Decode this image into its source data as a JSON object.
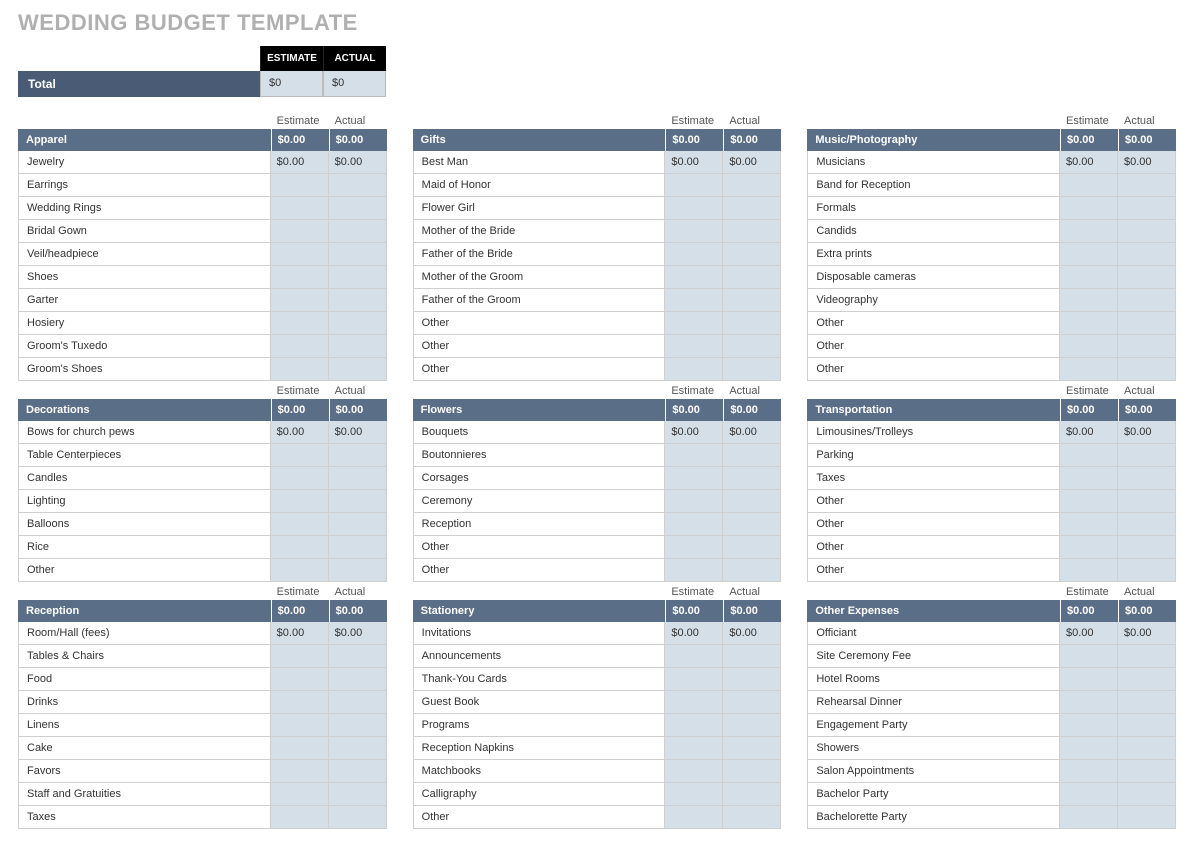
{
  "title": "WEDDING BUDGET TEMPLATE",
  "column_labels": {
    "estimate": "Estimate",
    "actual": "Actual"
  },
  "totals": {
    "head_estimate": "ESTIMATE",
    "head_actual": "ACTUAL",
    "label": "Total",
    "estimate": "$0",
    "actual": "$0"
  },
  "categories": [
    {
      "name": "Apparel",
      "estimate": "$0.00",
      "actual": "$0.00",
      "rows": [
        {
          "name": "Jewelry",
          "estimate": "$0.00",
          "actual": "$0.00"
        },
        {
          "name": "Earrings",
          "estimate": "",
          "actual": ""
        },
        {
          "name": "Wedding Rings",
          "estimate": "",
          "actual": ""
        },
        {
          "name": "Bridal Gown",
          "estimate": "",
          "actual": ""
        },
        {
          "name": "Veil/headpiece",
          "estimate": "",
          "actual": ""
        },
        {
          "name": "Shoes",
          "estimate": "",
          "actual": ""
        },
        {
          "name": "Garter",
          "estimate": "",
          "actual": ""
        },
        {
          "name": "Hosiery",
          "estimate": "",
          "actual": ""
        },
        {
          "name": "Groom's Tuxedo",
          "estimate": "",
          "actual": ""
        },
        {
          "name": "Groom's Shoes",
          "estimate": "",
          "actual": ""
        }
      ]
    },
    {
      "name": "Gifts",
      "estimate": "$0.00",
      "actual": "$0.00",
      "rows": [
        {
          "name": "Best Man",
          "estimate": "$0.00",
          "actual": "$0.00"
        },
        {
          "name": "Maid of Honor",
          "estimate": "",
          "actual": ""
        },
        {
          "name": "Flower Girl",
          "estimate": "",
          "actual": ""
        },
        {
          "name": "Mother of the Bride",
          "estimate": "",
          "actual": ""
        },
        {
          "name": "Father of the Bride",
          "estimate": "",
          "actual": ""
        },
        {
          "name": "Mother of the Groom",
          "estimate": "",
          "actual": ""
        },
        {
          "name": "Father of the Groom",
          "estimate": "",
          "actual": ""
        },
        {
          "name": "Other",
          "estimate": "",
          "actual": ""
        },
        {
          "name": "Other",
          "estimate": "",
          "actual": ""
        },
        {
          "name": "Other",
          "estimate": "",
          "actual": ""
        }
      ]
    },
    {
      "name": "Music/Photography",
      "estimate": "$0.00",
      "actual": "$0.00",
      "rows": [
        {
          "name": "Musicians",
          "estimate": "$0.00",
          "actual": "$0.00"
        },
        {
          "name": "Band for Reception",
          "estimate": "",
          "actual": ""
        },
        {
          "name": "Formals",
          "estimate": "",
          "actual": ""
        },
        {
          "name": "Candids",
          "estimate": "",
          "actual": ""
        },
        {
          "name": "Extra prints",
          "estimate": "",
          "actual": ""
        },
        {
          "name": "Disposable cameras",
          "estimate": "",
          "actual": ""
        },
        {
          "name": "Videography",
          "estimate": "",
          "actual": ""
        },
        {
          "name": "Other",
          "estimate": "",
          "actual": ""
        },
        {
          "name": "Other",
          "estimate": "",
          "actual": ""
        },
        {
          "name": "Other",
          "estimate": "",
          "actual": ""
        }
      ]
    },
    {
      "name": "Decorations",
      "estimate": "$0.00",
      "actual": "$0.00",
      "rows": [
        {
          "name": "Bows for church pews",
          "estimate": "$0.00",
          "actual": "$0.00"
        },
        {
          "name": "Table Centerpieces",
          "estimate": "",
          "actual": ""
        },
        {
          "name": "Candles",
          "estimate": "",
          "actual": ""
        },
        {
          "name": "Lighting",
          "estimate": "",
          "actual": ""
        },
        {
          "name": "Balloons",
          "estimate": "",
          "actual": ""
        },
        {
          "name": "Rice",
          "estimate": "",
          "actual": ""
        },
        {
          "name": "Other",
          "estimate": "",
          "actual": ""
        }
      ]
    },
    {
      "name": "Flowers",
      "estimate": "$0.00",
      "actual": "$0.00",
      "rows": [
        {
          "name": "Bouquets",
          "estimate": "$0.00",
          "actual": "$0.00"
        },
        {
          "name": "Boutonnieres",
          "estimate": "",
          "actual": ""
        },
        {
          "name": "Corsages",
          "estimate": "",
          "actual": ""
        },
        {
          "name": "Ceremony",
          "estimate": "",
          "actual": ""
        },
        {
          "name": "Reception",
          "estimate": "",
          "actual": ""
        },
        {
          "name": "Other",
          "estimate": "",
          "actual": ""
        },
        {
          "name": "Other",
          "estimate": "",
          "actual": ""
        }
      ]
    },
    {
      "name": "Transportation",
      "estimate": "$0.00",
      "actual": "$0.00",
      "rows": [
        {
          "name": "Limousines/Trolleys",
          "estimate": "$0.00",
          "actual": "$0.00"
        },
        {
          "name": "Parking",
          "estimate": "",
          "actual": ""
        },
        {
          "name": "Taxes",
          "estimate": "",
          "actual": ""
        },
        {
          "name": "Other",
          "estimate": "",
          "actual": ""
        },
        {
          "name": "Other",
          "estimate": "",
          "actual": ""
        },
        {
          "name": "Other",
          "estimate": "",
          "actual": ""
        },
        {
          "name": "Other",
          "estimate": "",
          "actual": ""
        }
      ]
    },
    {
      "name": "Reception",
      "estimate": "$0.00",
      "actual": "$0.00",
      "rows": [
        {
          "name": "Room/Hall (fees)",
          "estimate": "$0.00",
          "actual": "$0.00"
        },
        {
          "name": "Tables & Chairs",
          "estimate": "",
          "actual": ""
        },
        {
          "name": "Food",
          "estimate": "",
          "actual": ""
        },
        {
          "name": "Drinks",
          "estimate": "",
          "actual": ""
        },
        {
          "name": "Linens",
          "estimate": "",
          "actual": ""
        },
        {
          "name": "Cake",
          "estimate": "",
          "actual": ""
        },
        {
          "name": "Favors",
          "estimate": "",
          "actual": ""
        },
        {
          "name": "Staff and Gratuities",
          "estimate": "",
          "actual": ""
        },
        {
          "name": "Taxes",
          "estimate": "",
          "actual": ""
        }
      ]
    },
    {
      "name": "Stationery",
      "estimate": "$0.00",
      "actual": "$0.00",
      "rows": [
        {
          "name": "Invitations",
          "estimate": "$0.00",
          "actual": "$0.00"
        },
        {
          "name": "Announcements",
          "estimate": "",
          "actual": ""
        },
        {
          "name": "Thank-You Cards",
          "estimate": "",
          "actual": ""
        },
        {
          "name": "Guest Book",
          "estimate": "",
          "actual": ""
        },
        {
          "name": "Programs",
          "estimate": "",
          "actual": ""
        },
        {
          "name": "Reception Napkins",
          "estimate": "",
          "actual": ""
        },
        {
          "name": "Matchbooks",
          "estimate": "",
          "actual": ""
        },
        {
          "name": "Calligraphy",
          "estimate": "",
          "actual": ""
        },
        {
          "name": "Other",
          "estimate": "",
          "actual": ""
        }
      ]
    },
    {
      "name": "Other Expenses",
      "estimate": "$0.00",
      "actual": "$0.00",
      "rows": [
        {
          "name": "Officiant",
          "estimate": "$0.00",
          "actual": "$0.00"
        },
        {
          "name": "Site Ceremony Fee",
          "estimate": "",
          "actual": ""
        },
        {
          "name": "Hotel Rooms",
          "estimate": "",
          "actual": ""
        },
        {
          "name": "Rehearsal Dinner",
          "estimate": "",
          "actual": ""
        },
        {
          "name": "Engagement Party",
          "estimate": "",
          "actual": ""
        },
        {
          "name": "Showers",
          "estimate": "",
          "actual": ""
        },
        {
          "name": "Salon Appointments",
          "estimate": "",
          "actual": ""
        },
        {
          "name": "Bachelor Party",
          "estimate": "",
          "actual": ""
        },
        {
          "name": "Bachelorette Party",
          "estimate": "",
          "actual": ""
        }
      ]
    }
  ]
}
